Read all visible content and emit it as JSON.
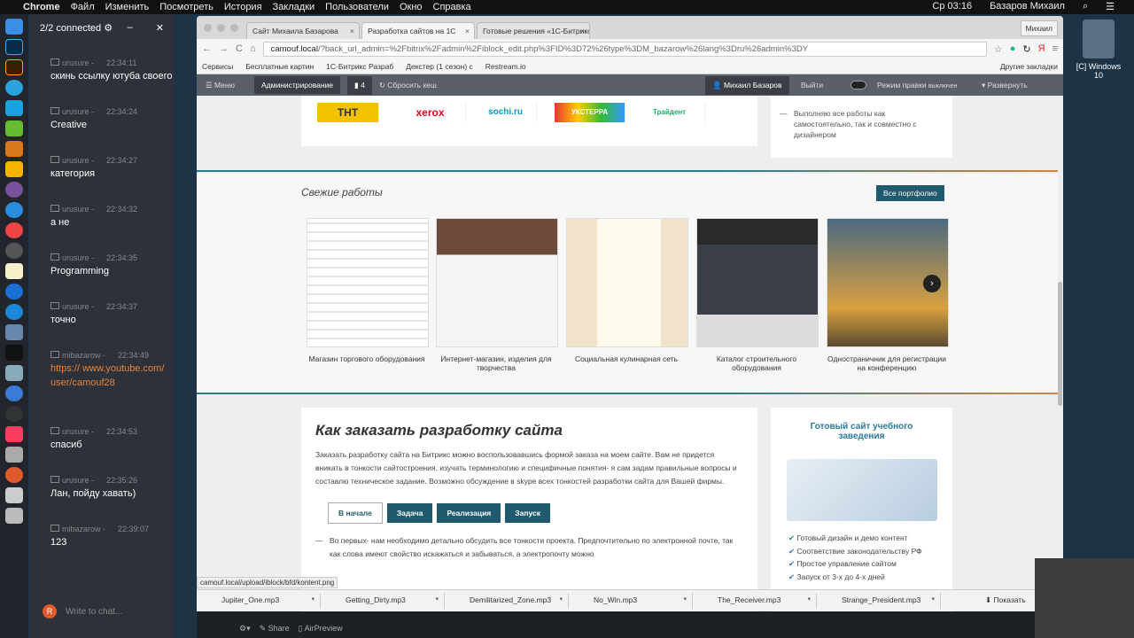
{
  "menubar": {
    "app": "Chrome",
    "items": [
      "Файл",
      "Изменить",
      "Посмотреть",
      "История",
      "Закладки",
      "Пользователи",
      "Окно",
      "Справка"
    ],
    "clock": "Ср 03:16",
    "user": "Базаров Михаил"
  },
  "chat": {
    "status": "2/2 connected",
    "input_placeholder": "Write to chat...",
    "messages": [
      {
        "user": "urusure -",
        "time": "22:34:11",
        "text": "скинь ссылку ютуба своего"
      },
      {
        "user": "urusure -",
        "time": "22:34:24",
        "text": "Creative"
      },
      {
        "user": "urusure -",
        "time": "22:34:27",
        "text": "категория"
      },
      {
        "user": "urusure -",
        "time": "22:34:32",
        "text": "а не"
      },
      {
        "user": "urusure -",
        "time": "22:34:35",
        "text": "Programming"
      },
      {
        "user": "urusure -",
        "time": "22:34:37",
        "text": "точно"
      },
      {
        "user": "mibazarow -",
        "time": "22:34:49",
        "text": "https:// www.youtube.com/ user/camouf28",
        "link": true
      },
      {
        "user": "urusure -",
        "time": "22:34:53",
        "text": "спасиб"
      },
      {
        "user": "urusure -",
        "time": "22:35:26",
        "text": "Лан, пойду хавать)"
      },
      {
        "user": "mibazarow -",
        "time": "22:39:07",
        "text": "123"
      }
    ]
  },
  "browser": {
    "tabs": [
      "Сайт Михаила Базарова",
      "Разработка сайтов на 1С",
      "Готовые решения «1С-Битрикс»"
    ],
    "profile": "Михаил",
    "url_host": "camouf.local",
    "url_rest": "/?back_url_admin=%2Fbitrix%2Fadmin%2Fiblock_edit.php%3FID%3D72%26type%3DM_bazarow%26lang%3Dru%26admin%3DY",
    "bookmarks": [
      "Сервисы",
      "Бесплатные картин",
      "1С-Битрикс Разраб",
      "Декстер (1 сезон) с",
      "Restream.io"
    ],
    "other_bookmarks": "Другие закладки",
    "status_url": "camouf.local/upload/iblock/bfd/kontent.png"
  },
  "admin": {
    "menu": "Меню",
    "admin": "Администрирование",
    "count": "4",
    "clear_cache": "Сбросить кеш",
    "user": "Михаил Базаров",
    "logout": "Выйти",
    "edit_mode": "Режим правки",
    "edit_state": "выключен",
    "expand": "Развернуть"
  },
  "page": {
    "logos": [
      "ТНТ",
      "xerox",
      "sochi.ru",
      "УКСТЕРРА",
      "Трайдент"
    ],
    "side_top": "Выполняю все работы как самостоятельно, так и совместно с дизайнером",
    "works_title": "Свежие работы",
    "portfolio_btn": "Все портфолио",
    "works": [
      "Магазин торгового оборудования",
      "Интернет-магазин, изделия для творчества",
      "Социальная кулинарная сеть",
      "Каталог строительного оборудования",
      "Одностраничник для регистрации на конференцию"
    ],
    "order_title": "Как заказать разработку сайта",
    "order_text": "Заказать разработку сайта на Битрикс можно воспользовавшись формой заказа на моем сайте. Вам не придется вникать в тонкости сайтостроения, изучать терминологию и специфичные понятия- я сам задам правильные вопросы и составлю техническое задание. Возможно обсуждение в skype всех тонкостей разработки сайта для Вашей фирмы.",
    "steps": [
      "В начале",
      "Задача",
      "Реализация",
      "Запуск"
    ],
    "step_text": "Во первых- нам необходимо детально обсудить все тонкости проекта. Предпочтительно по электронной почте, так как слова имеют свойство искажаться и забываться, а электропочту можно",
    "promo_title": "Готовый сайт учебного заведения",
    "promo_items": [
      "Готовый дизайн и демо контент",
      "Соответствие законодательству РФ",
      "Простое управление сайтом",
      "Запуск от 3-х до 4-х дней"
    ]
  },
  "downloads": {
    "files": [
      "Jupiter_One.mp3",
      "Getting_Dirty.mp3",
      "Demilitarized_Zone.mp3",
      "No_Win.mp3",
      "The_Receiver.mp3",
      "Strange_President.mp3"
    ],
    "show_all": "Показать"
  },
  "editor": {
    "share": "Share",
    "airpreview": "AirPreview"
  },
  "desktop": {
    "drive": "[C] Windows 10"
  }
}
